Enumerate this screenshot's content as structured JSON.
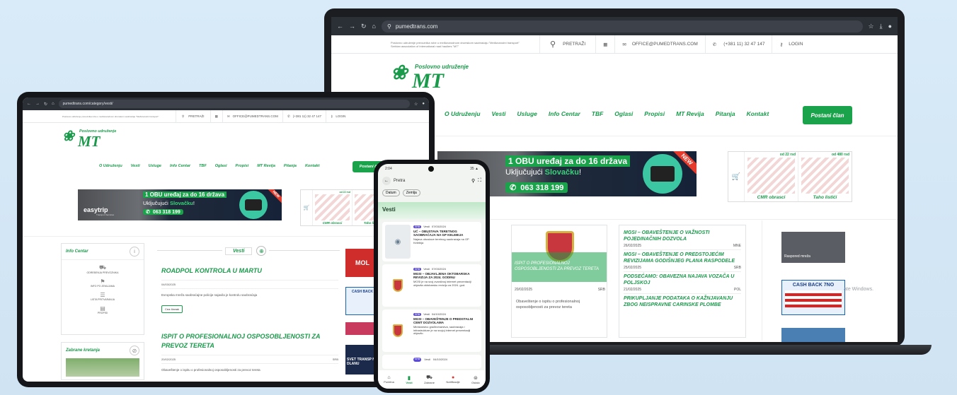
{
  "site": {
    "url_home": "pumedtrans.com",
    "url_vesti": "pumedtrans.com/category/vesti/",
    "tagline": "Poslovno udruženje prevoznika robe u međunarodnom drumskom saobraćaju \"Međunarodni transport\"",
    "tagline2": "Serbian association of international road hauliers \"MT\"",
    "search": "PRETRAŽI",
    "email": "OFFICE@PUMEDTRANS.COM",
    "phone": "(+381 11) 32 47 147",
    "login": "LOGIN",
    "logo_sub": "Poslovno udruženje",
    "logo_mt": "MT"
  },
  "nav": [
    "O Udruženju",
    "Vesti",
    "Usluge",
    "Info Centar",
    "TBF",
    "Oglasi",
    "Propisi",
    "MT Revija",
    "Pitanja",
    "Kontakt"
  ],
  "join": "Postani član",
  "banner": {
    "line1": "1 OBU uređaj za do 16 država",
    "line2a": "Uključujući ",
    "line2b": "Slovačku",
    "line2c": "!",
    "phone": "063 318 199",
    "new": "NEW",
    "brand": "easytrip",
    "brand_sub": "Transport Services"
  },
  "shop": {
    "price1": "od 22 rsd",
    "price2": "od 480 rsd",
    "item1": "CMR obrasci",
    "item2": "Taho listići"
  },
  "laptop_news": {
    "card_title": "ISPIT O PROFESIONALNOJ OSPOSOBLJENOSTI ZA PREVOZ TERETA",
    "card_date": "20/02/2025",
    "card_tag": "SRB",
    "card_text": "Obaveštenje o ispitu o profesionalnoj osposobljenosti za prevoz tereta",
    "items": [
      {
        "title": "MGSI – OBAVEŠTENJE O VAŽNOSTI POJEDINAČNIH DOZVOLA",
        "date": "26/02/2025",
        "tag": "MNE"
      },
      {
        "title": "MGSI – OBAVEŠTENJE O PREDSTOJEĆIM REVIZIJAMA GODIŠNJEG PLANA RASPODELE",
        "date": "25/02/2025",
        "tag": "SRB"
      },
      {
        "title": "PODSEĆAMO: OBAVEZNA NAJAVA VOZAČA U POLJSKOJ",
        "date": "21/02/2025",
        "tag": "POL"
      },
      {
        "title": "PRIKUPLJANJE PODATAKA O KAŽNJAVANJU ZBOG NEISPRAVNE CARINSKE PLOMBE",
        "date": "",
        "tag": ""
      }
    ],
    "side_label": "Raspored mreža",
    "cashback": "CASH BACK 7NO",
    "windows": "ate Windows."
  },
  "tablet": {
    "info_title": "Info Centar",
    "info_items": [
      "ODREĐENJA PREVOZNIKA",
      "INFO PO ZEMLJAMA",
      "LISTA PRITVARANJA",
      "PROPISI"
    ],
    "zabrane": "Zabrane kretanja",
    "vesti": "Vesti",
    "posts": [
      {
        "title": "ROADPOL KONTROLA U MARTU",
        "date": "04/03/2025",
        "text": "Evropska mreža saobraćajne policije najavila je kontrolu saobraćaja",
        "btn": "Cea članak"
      },
      {
        "title": "ISPIT O PROFESIONALNOJ OSPOSOBLJENOSTI ZA PREVOZ TERETA",
        "date": "20/02/2025",
        "tag": "SRB",
        "text": "Obaveštenje o ispitu o profesionalnoj osposobljenosti za prevoz tereta"
      }
    ],
    "ads": [
      "MOL",
      "CASH BACK",
      "SVET TRANSP NA DLANU"
    ]
  },
  "phone": {
    "status": "2:04",
    "battery": "35 ▲",
    "search": "Pretra",
    "filters": [
      "Datum",
      "Zemlja"
    ],
    "section": "Vesti",
    "news": [
      {
        "badge": "SRB",
        "cat": "Vesti",
        "date": "07/03/2024",
        "title": "UĆ – OBUSTAVA TERETNOG SAOBRAĆAJA NA GP KELEBIJA",
        "text": "Najava obustave teretnog saobraćaja na GP Kelebija"
      },
      {
        "badge": "SRB",
        "cat": "Vesti",
        "date": "07/03/2024",
        "title": "MGSI – OBJAVLJENA OKTOBARSKA REVIZIJA ZA 2024. GODINU",
        "text": "MGSI je na svoj zvaničnoj internet prezentaciji objavila oktobarsku reviziju za 2024. god."
      },
      {
        "badge": "SRB",
        "cat": "Vesti",
        "date": "04/10/2024",
        "title": "MGSI – OBAVEŠTENJE O PREDSTALNI CEMT DOZVOLAMA",
        "text": "Ministarstvo građevinarstva, saobraćaja i infrastrukture je na svojoj internet prezentaciji objavilo"
      },
      {
        "badge": "SRB",
        "cat": "Vesti",
        "date": "04/10/2024",
        "title": "",
        "text": ""
      }
    ],
    "tabs": [
      "Početna",
      "Vesti",
      "Zabrane",
      "Notifikacije",
      "Ostalo"
    ]
  }
}
